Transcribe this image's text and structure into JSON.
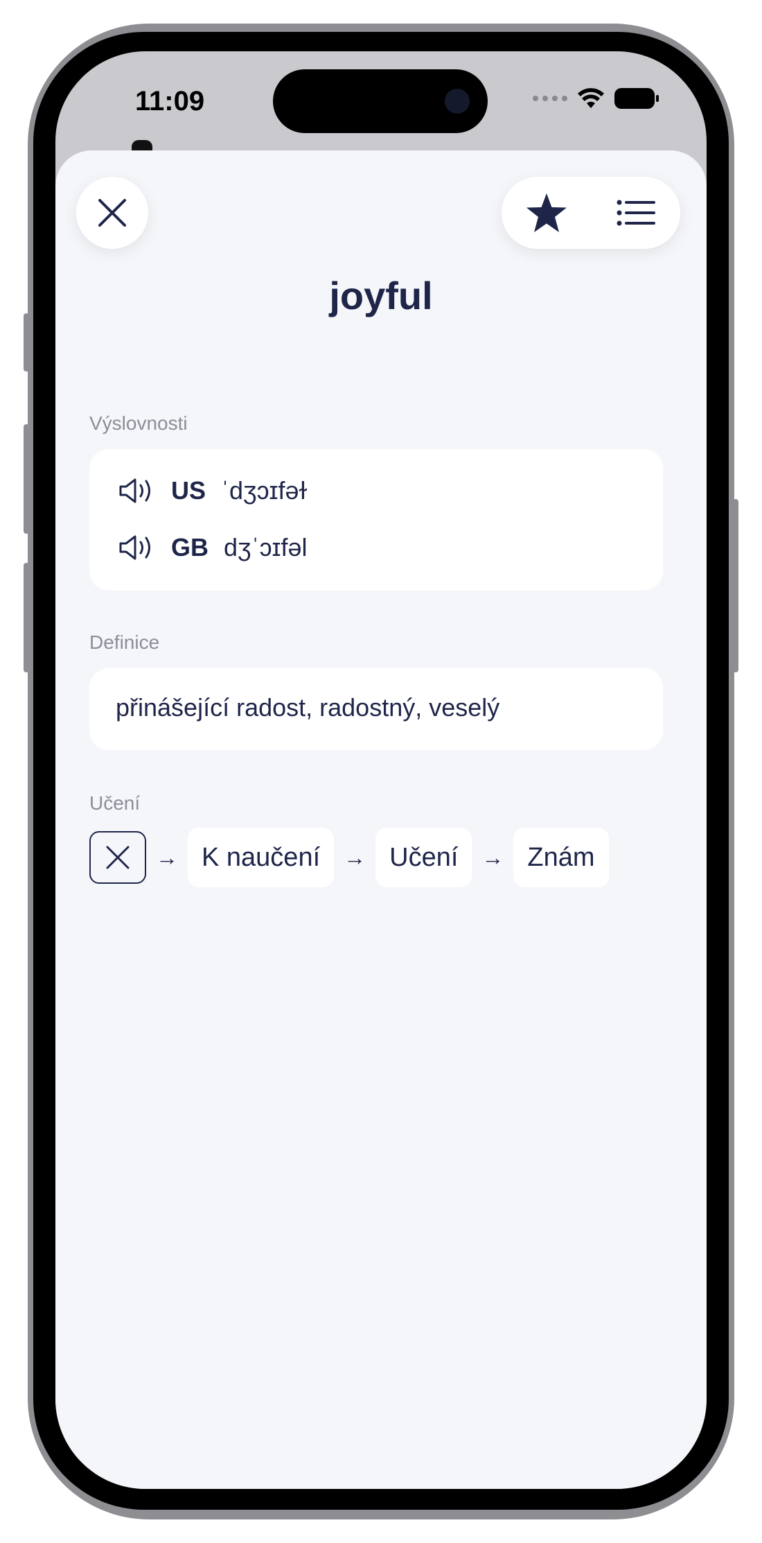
{
  "status_bar": {
    "time": "11:09"
  },
  "header": {
    "close_icon": "close-icon",
    "favorite_icon": "star-icon",
    "list_icon": "list-icon"
  },
  "word": "joyful",
  "pronunciations": {
    "label": "Výslovnosti",
    "items": [
      {
        "region": "US",
        "ipa": "ˈdʒɔɪfəɫ"
      },
      {
        "region": "GB",
        "ipa": "dʒˈɔɪfəl"
      }
    ]
  },
  "definition": {
    "label": "Definice",
    "text": "přinášející radost, radostný, veselý"
  },
  "learning": {
    "label": "Učení",
    "arrow": "→",
    "stages": [
      "K naučení",
      "Učení",
      "Znám"
    ]
  },
  "colors": {
    "text": "#1e2549",
    "background": "#f5f6fa",
    "muted": "#8b8d98"
  }
}
